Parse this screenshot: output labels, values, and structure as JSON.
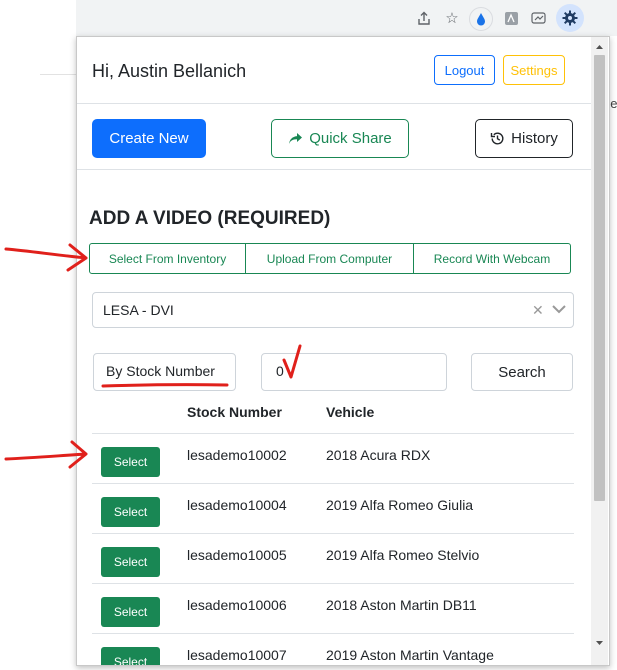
{
  "browser": {
    "toolbar_icons": [
      "share-icon",
      "star-icon",
      "drop-extension-icon",
      "pdf-extension-icon",
      "draw-extension-icon",
      "gear-extension-icon"
    ],
    "background_text": "ge"
  },
  "popup": {
    "greeting": "Hi, Austin Bellanich",
    "logout_label": "Logout",
    "settings_label": "Settings",
    "create_new_label": "Create New",
    "quick_share_label": "Quick Share",
    "history_label": "History",
    "section_title": "ADD A VIDEO (REQUIRED)",
    "tabs": [
      {
        "label": "Select From Inventory"
      },
      {
        "label": "Upload From Computer"
      },
      {
        "label": "Record With Webcam"
      }
    ],
    "dealer_select": {
      "value": "LESA - DVI"
    },
    "search": {
      "mode_value": "By Stock Number",
      "query_value": "0",
      "button_label": "Search"
    },
    "table": {
      "headers": [
        "Stock Number",
        "Vehicle"
      ],
      "select_label": "Select",
      "rows": [
        {
          "stock": "lesademo10002",
          "vehicle": "2018 Acura RDX"
        },
        {
          "stock": "lesademo10004",
          "vehicle": "2019 Alfa Romeo Giulia"
        },
        {
          "stock": "lesademo10005",
          "vehicle": "2019 Alfa Romeo Stelvio"
        },
        {
          "stock": "lesademo10006",
          "vehicle": "2018 Aston Martin DB11"
        },
        {
          "stock": "lesademo10007",
          "vehicle": "2019 Aston Martin Vantage"
        }
      ]
    }
  },
  "colors": {
    "primary": "#0d6efd",
    "success": "#198754",
    "warning": "#ffc107",
    "annotation": "#e0201b"
  }
}
